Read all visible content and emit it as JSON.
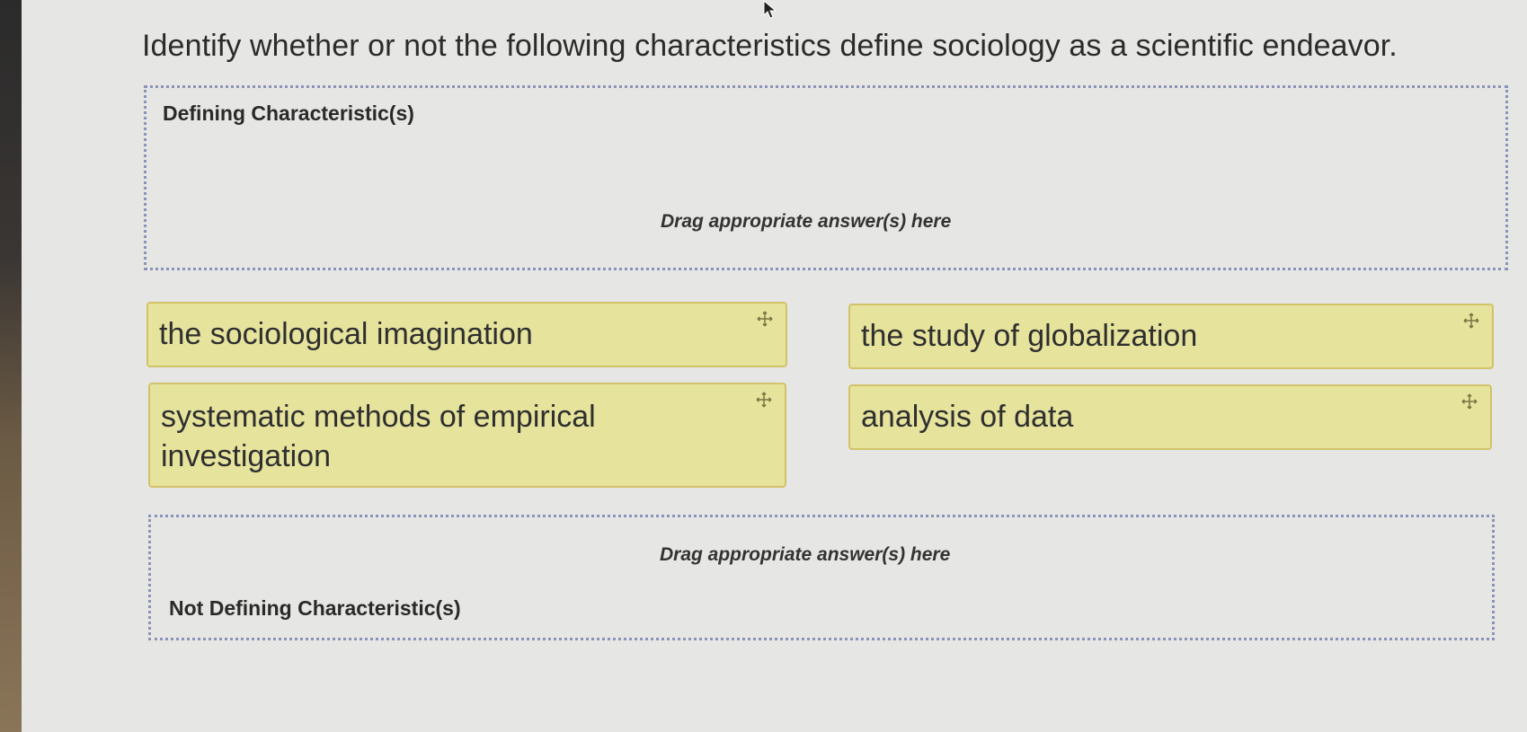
{
  "question": "Identify whether or not the following characteristics define sociology as a scientific endeavor.",
  "zones": {
    "defining": {
      "title": "Defining Characteristic(s)",
      "hint": "Drag appropriate answer(s) here"
    },
    "not_defining": {
      "title": "Not Defining Characteristic(s)",
      "hint": "Drag appropriate answer(s) here"
    }
  },
  "cards": [
    {
      "label": "the sociological imagination",
      "icon": "move-icon"
    },
    {
      "label": "the study of globalization",
      "icon": "move-icon"
    },
    {
      "label": "systematic methods of empirical investigation",
      "icon": "move-icon"
    },
    {
      "label": "analysis of data",
      "icon": "move-icon"
    }
  ],
  "colors": {
    "card_fill": "#e6e39d",
    "card_border": "#d2c36a",
    "zone_border": "#8a93b8"
  }
}
